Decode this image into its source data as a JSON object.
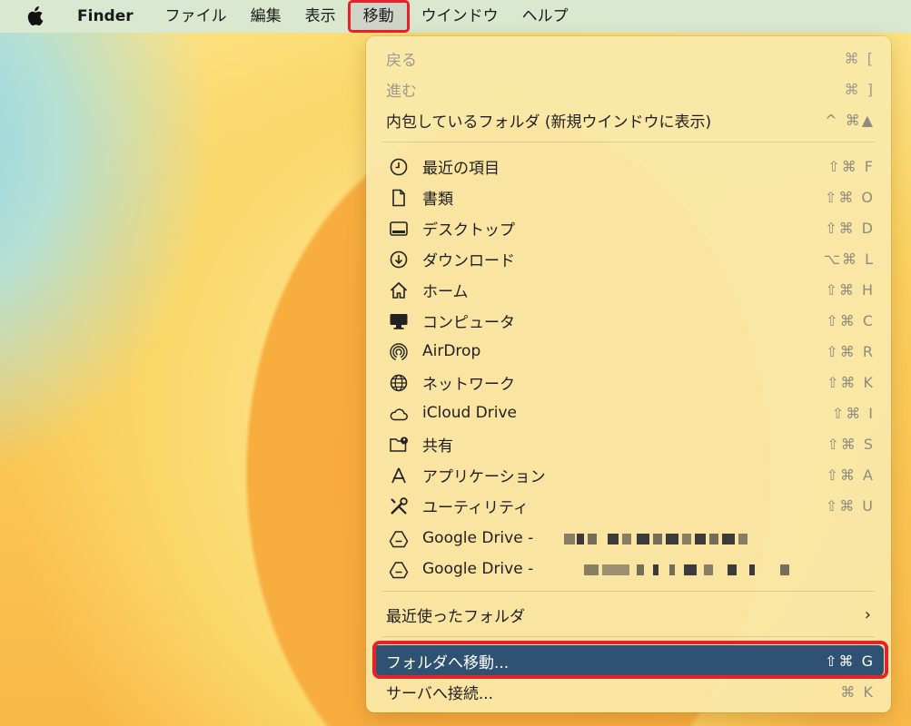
{
  "menubar": {
    "app": "Finder",
    "items": [
      "ファイル",
      "編集",
      "表示",
      "移動",
      "ウインドウ",
      "ヘルプ"
    ]
  },
  "menu": {
    "back": {
      "label": "戻る",
      "shortcut": "⌘ ["
    },
    "forward": {
      "label": "進む",
      "shortcut": "⌘ ]"
    },
    "enclosing": {
      "label": "内包しているフォルダ (新規ウインドウに表示)",
      "shortcut": "^ ⌘▲"
    },
    "places": [
      {
        "label": "最近の項目",
        "shortcut": "⇧⌘ F",
        "icon": "clock-icon"
      },
      {
        "label": "書類",
        "shortcut": "⇧⌘ O",
        "icon": "document-icon"
      },
      {
        "label": "デスクトップ",
        "shortcut": "⇧⌘ D",
        "icon": "desktop-icon"
      },
      {
        "label": "ダウンロード",
        "shortcut": "⌥⌘ L",
        "icon": "download-icon"
      },
      {
        "label": "ホーム",
        "shortcut": "⇧⌘ H",
        "icon": "home-icon"
      },
      {
        "label": "コンピュータ",
        "shortcut": "⇧⌘ C",
        "icon": "computer-icon"
      },
      {
        "label": "AirDrop",
        "shortcut": "⇧⌘ R",
        "icon": "airdrop-icon"
      },
      {
        "label": "ネットワーク",
        "shortcut": "⇧⌘ K",
        "icon": "network-icon"
      },
      {
        "label": "iCloud Drive",
        "shortcut": "⇧⌘ I",
        "icon": "cloud-icon"
      },
      {
        "label": "共有",
        "shortcut": "⇧⌘ S",
        "icon": "shared-folder-icon"
      },
      {
        "label": "アプリケーション",
        "shortcut": "⇧⌘ A",
        "icon": "applications-icon"
      },
      {
        "label": "ユーティリティ",
        "shortcut": "⇧⌘ U",
        "icon": "utilities-icon"
      },
      {
        "label": "Google Drive -",
        "shortcut": "",
        "icon": "google-drive-icon"
      },
      {
        "label": "Google Drive -",
        "shortcut": "",
        "icon": "google-drive-icon"
      }
    ],
    "recent_folders": {
      "label": "最近使ったフォルダ",
      "chevron": "›"
    },
    "go_to_folder": {
      "label": "フォルダへ移動...",
      "shortcut": "⇧⌘ G"
    },
    "connect_server": {
      "label": "サーバへ接続...",
      "shortcut": "⌘ K"
    }
  },
  "colors": {
    "highlight": "#2f5272",
    "annotation": "#e8202a"
  }
}
